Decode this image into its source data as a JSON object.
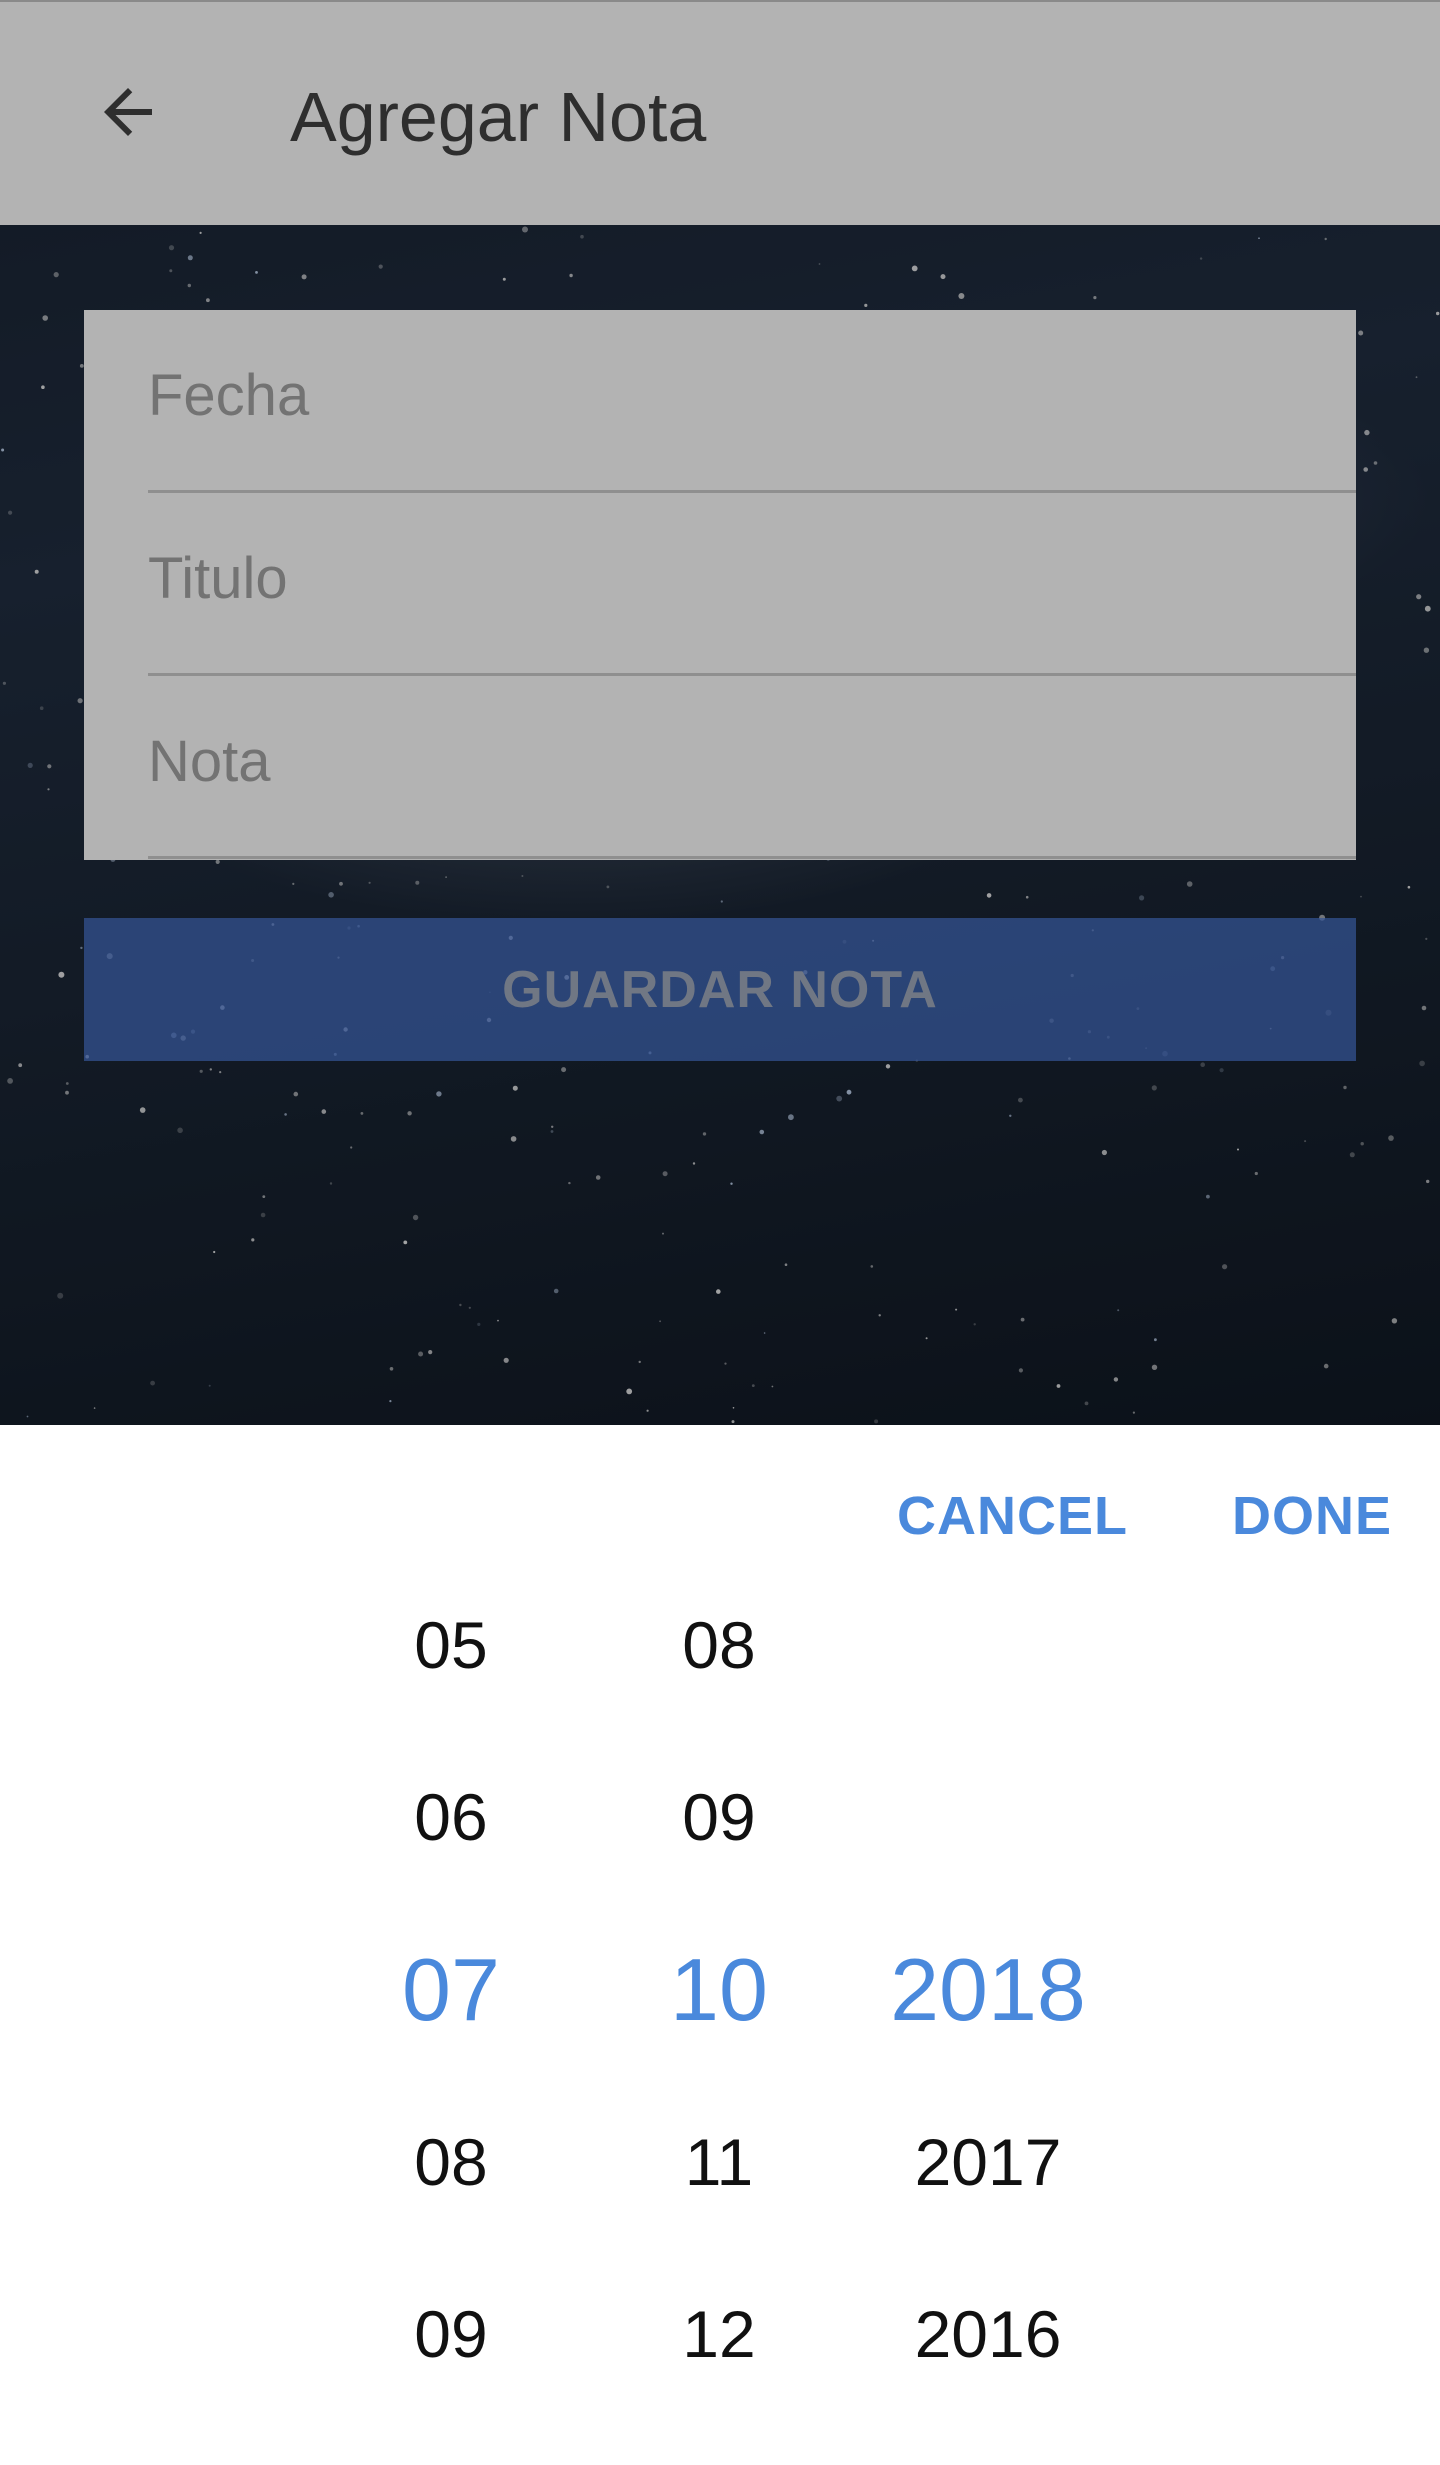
{
  "app_bar": {
    "title": "Agregar Nota",
    "back_icon": "arrow-back-icon"
  },
  "form": {
    "fecha_placeholder": "Fecha",
    "titulo_placeholder": "Titulo",
    "nota_placeholder": "Nota",
    "save_label": "GUARDAR NOTA"
  },
  "date_picker": {
    "cancel_label": "CANCEL",
    "done_label": "DONE",
    "day": {
      "items": [
        "05",
        "06",
        "07",
        "08",
        "09"
      ],
      "selected": "07"
    },
    "month": {
      "items": [
        "08",
        "09",
        "10",
        "11",
        "12"
      ],
      "selected": "10"
    },
    "year": {
      "items": [
        "",
        "",
        "2018",
        "2017",
        "2016"
      ],
      "selected": "2018"
    }
  },
  "colors": {
    "accent": "#4a89dc",
    "save_button": "#345496"
  }
}
